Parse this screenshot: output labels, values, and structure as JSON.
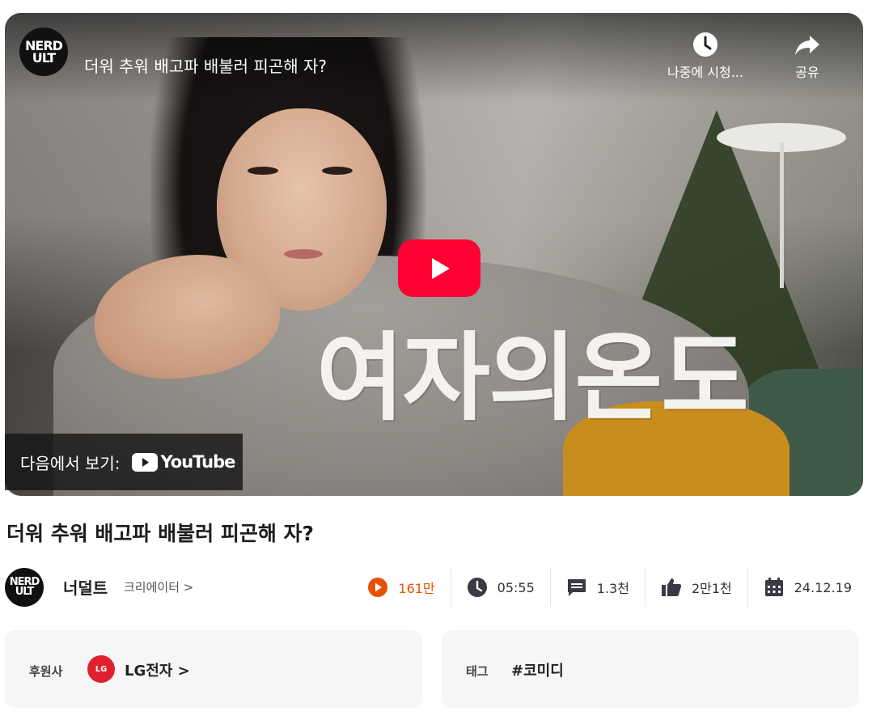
{
  "player": {
    "title": "더워 추워 배고파 배불러 피곤해 자?",
    "thumbnail_caption": "여자의온도",
    "channel_logo_line1": "NERD",
    "channel_logo_line2": "ULT",
    "watch_later_label": "나중에 시청...",
    "share_label": "공유",
    "watch_on_label": "다음에서 보기:",
    "youtube_wordmark": "YouTube"
  },
  "video": {
    "title": "더워 추워 배고파 배불러 피곤해 자?"
  },
  "channel": {
    "name": "너덜트",
    "creator_link": "크리에이터 >",
    "logo_line1": "NERD",
    "logo_line2": "ULT"
  },
  "stats": {
    "views": "161만",
    "duration": "05:55",
    "comments": "1.3천",
    "likes": "2만1천",
    "date": "24.12.19"
  },
  "sponsor": {
    "key": "후원사",
    "logo_text": "LG",
    "name": "LG전자 >"
  },
  "tags": {
    "key": "태그",
    "value": "#코미디"
  },
  "colors": {
    "play_button": "#ff0033",
    "views_accent": "#e65100",
    "card_background": "#f6f6f6",
    "sponsor_red": "#e0202f"
  },
  "icons": {
    "watch_later": "clock-icon",
    "share": "share-arrow-icon",
    "play": "play-icon",
    "views": "play-circle-icon",
    "duration": "clock-icon",
    "comments": "comment-icon",
    "likes": "thumbs-up-icon",
    "date": "calendar-icon"
  }
}
